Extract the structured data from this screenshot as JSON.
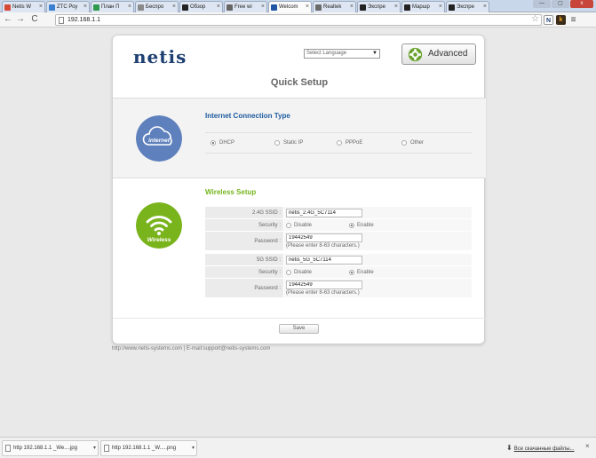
{
  "browser": {
    "tabs": [
      {
        "label": "Netis W",
        "color": "#d64937"
      },
      {
        "label": "ZTC Роу",
        "color": "#3a7fd0"
      },
      {
        "label": "План П",
        "color": "#2f9a4e"
      },
      {
        "label": "Беспро",
        "color": "#8a8a8a"
      },
      {
        "label": "Обзор",
        "color": "#222222"
      },
      {
        "label": "Free wi",
        "color": "#666666"
      },
      {
        "label": "Welcom",
        "color": "#2156a5"
      },
      {
        "label": "Realtek",
        "color": "#6a6a6a"
      },
      {
        "label": "Экспре",
        "color": "#222222"
      },
      {
        "label": "Маршр",
        "color": "#222222"
      },
      {
        "label": "Экспре",
        "color": "#222222"
      }
    ],
    "active_tab_index": 6,
    "window_controls": [
      "—",
      "▢",
      "x"
    ],
    "back_icon": "←",
    "forward_icon": "→",
    "reload_icon": "C",
    "url": "192.168.1.1",
    "extensions": [
      {
        "label": "N",
        "bg": "#ffffff",
        "fg": "#1e3f72"
      },
      {
        "label": "k",
        "bg": "#3a2b1a",
        "fg": "#f5a623"
      },
      {
        "label": "≡",
        "bg": "#f5f5f5",
        "fg": "#444444"
      }
    ]
  },
  "header": {
    "logo": "netis",
    "language_placeholder": "Select Language",
    "advanced_label": "Advanced"
  },
  "page_title": "Quick Setup",
  "internet": {
    "title": "Internet Connection Type",
    "icon_label": "internet",
    "options": [
      "DHCP",
      "Static IP",
      "PPPoE",
      "Other"
    ],
    "selected": "DHCP"
  },
  "wireless": {
    "title": "Wireless Setup",
    "icon_label": "Wireless",
    "band24": {
      "ssid_label": "2.4G SSID :",
      "ssid": "netis_2.4G_5C7114",
      "security_label": "Security :",
      "disable": "Disable",
      "enable": "Enable",
      "password_label": "Password :",
      "password": "19442549",
      "hint": "(Please enter 8-63 characters.)"
    },
    "band5": {
      "ssid_label": "5G SSID :",
      "ssid": "netis_5G_5C7114",
      "security_label": "Security :",
      "disable": "Disable",
      "enable": "Enable",
      "password_label": "Password :",
      "password": "19442549",
      "hint": "(Please enter 8-63 characters.)"
    }
  },
  "save_label": "Save",
  "footer": "http://www.netis-systems.com | E-mail:support@netis-systems.com",
  "downloads": {
    "items": [
      "http 192.168.1.1 _We....jpg",
      "http 192.168.1.1 _W.....png"
    ],
    "chevron": "▾",
    "all_downloads_label": "Все скачанные файлы...",
    "close": "×"
  },
  "colors": {
    "logo": "#1e3f72",
    "internet_circle": "#5e80bd",
    "wireless_circle": "#7ab41d",
    "section_title_blue": "#1c5a9e",
    "section_title_green": "#76b51e"
  }
}
